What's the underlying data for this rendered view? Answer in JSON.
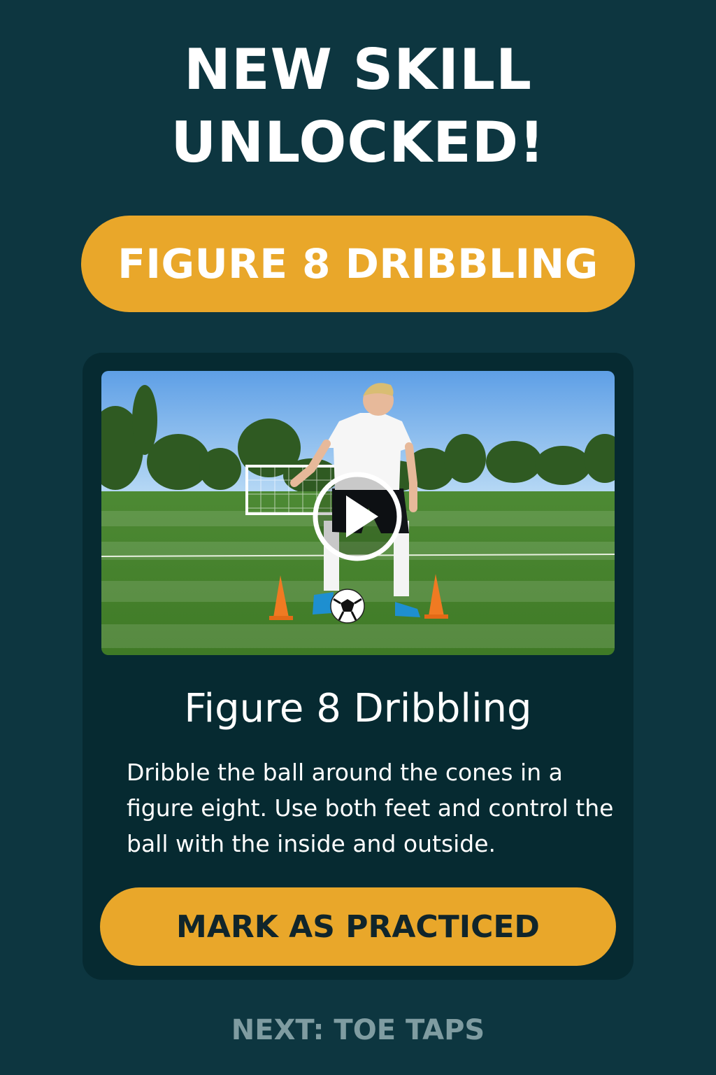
{
  "header": {
    "line1": "NEW SKILL",
    "line2": "UNLOCKED!"
  },
  "skill_badge": "FIGURE 8 DRIBBLING",
  "card": {
    "video": {
      "icon": "play-icon"
    },
    "title": "Figure 8 Dribbling",
    "description": "Dribble the ball around the cones in a figure eight. Use both feet and control the ball with the inside and outside.",
    "cta_label": "MARK AS PRACTICED"
  },
  "next_label": "NEXT: TOE TAPS",
  "colors": {
    "background": "#0d3640",
    "card": "#062a31",
    "accent": "#e9a72a",
    "next_text": "#7f9ca1"
  }
}
